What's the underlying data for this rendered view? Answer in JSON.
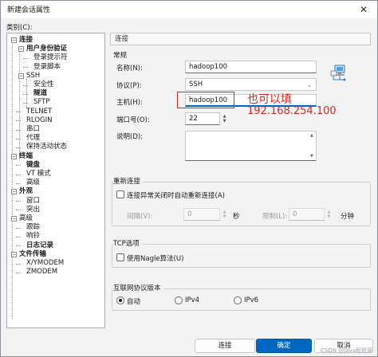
{
  "window": {
    "title": "新建会话属性",
    "close_glyph": "✕"
  },
  "category_label": "类别(C):",
  "tree": [
    {
      "label": "连接",
      "bold": true,
      "expander": "⊟"
    },
    {
      "label": "用户身份验证",
      "bold": true,
      "expander": "⊟"
    },
    {
      "label": "登录提示符",
      "bold": false
    },
    {
      "label": "登录脚本",
      "bold": false
    },
    {
      "label": "SSH",
      "bold": false,
      "expander": "⊟"
    },
    {
      "label": "安全性",
      "bold": false
    },
    {
      "label": "隧道",
      "bold": true
    },
    {
      "label": "SFTP",
      "bold": false
    },
    {
      "label": "TELNET",
      "bold": false
    },
    {
      "label": "RLOGIN",
      "bold": false
    },
    {
      "label": "串口",
      "bold": false
    },
    {
      "label": "代理",
      "bold": false
    },
    {
      "label": "保持活动状态",
      "bold": false
    },
    {
      "label": "终端",
      "bold": true,
      "expander": "⊟"
    },
    {
      "label": "键盘",
      "bold": true
    },
    {
      "label": "VT 模式",
      "bold": false
    },
    {
      "label": "高级",
      "bold": false
    },
    {
      "label": "外观",
      "bold": true,
      "expander": "⊟"
    },
    {
      "label": "窗口",
      "bold": false
    },
    {
      "label": "突出",
      "bold": false
    },
    {
      "label": "高级",
      "bold": false,
      "expander": "⊟"
    },
    {
      "label": "跟踪",
      "bold": false
    },
    {
      "label": "响铃",
      "bold": false
    },
    {
      "label": "日志记录",
      "bold": true
    },
    {
      "label": "文件传输",
      "bold": true,
      "expander": "⊟"
    },
    {
      "label": "X/YMODEM",
      "bold": false
    },
    {
      "label": "ZMODEM",
      "bold": false
    }
  ],
  "panel": {
    "title": "连接",
    "general": {
      "section": "常规",
      "name_label": "名称(N):",
      "name_value": "hadoop100",
      "protocol_label": "协议(P):",
      "protocol_value": "SSH",
      "host_label": "主机(H):",
      "host_value": "hadoop100",
      "port_label": "端口号(O):",
      "port_value": "22",
      "desc_label": "说明(D):",
      "desc_value": ""
    },
    "reconnect": {
      "section": "重新连接",
      "checkbox_label": "连接异常关闭时自动重新连接(A)",
      "interval_label": "间隔(V):",
      "interval_value": "0",
      "interval_unit": "秒",
      "limit_label": "限制(L):",
      "limit_value": "0",
      "limit_unit": "分钟"
    },
    "tcp": {
      "section": "TCP选项",
      "nagle_label": "使用Nagle算法(U)"
    },
    "ip": {
      "section": "互联网协议版本",
      "options": [
        "自动",
        "IPv4",
        "IPv6"
      ],
      "selected": "自动"
    }
  },
  "annotation": {
    "line1": "也可以填",
    "line2": "192.168.254.100",
    "color": "#e0261b"
  },
  "buttons": {
    "connect": "连接",
    "ok": "确定",
    "cancel": "取消"
  },
  "watermark": "CSDN @Java程旭源",
  "colors": {
    "accent": "#0067c0"
  }
}
